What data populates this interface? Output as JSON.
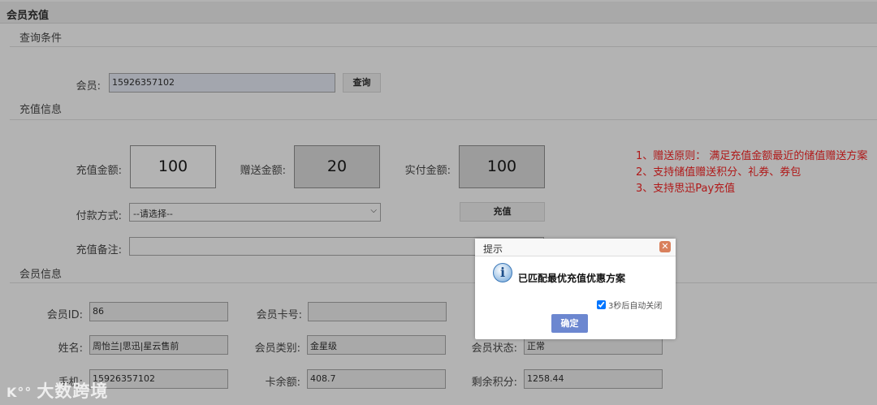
{
  "page": {
    "title": "会员充值"
  },
  "query": {
    "section": "查询条件",
    "member_label": "会员:",
    "member_value": "15926357102",
    "query_button": "查询"
  },
  "recharge": {
    "section": "充值信息",
    "amount_label": "充值金额:",
    "amount": "100",
    "bonus_label": "赠送金额:",
    "bonus": "20",
    "paid_label": "实付金额:",
    "paid": "100",
    "payment_label": "付款方式:",
    "payment_selected": "--请选择--",
    "recharge_button": "充值",
    "remark_label": "充值备注:",
    "remark_value": "",
    "notes": [
      "1、赠送原则： 满足充值金额最近的储值赠送方案",
      "2、支持储值赠送积分、礼券、券包",
      "3、支持思迅Pay充值"
    ]
  },
  "member": {
    "section": "会员信息",
    "fields": [
      {
        "label": "会员ID:",
        "value": "86"
      },
      {
        "label": "会员卡号:",
        "value": ""
      },
      {
        "label": "姓名:",
        "value": "周怡兰|思迅|星云售前"
      },
      {
        "label": "会员类别:",
        "value": "金星级"
      },
      {
        "label": "会员状态:",
        "value": "正常"
      },
      {
        "label": "手机:",
        "value": "15926357102"
      },
      {
        "label": "卡余额:",
        "value": "408.7"
      },
      {
        "label": "剩余积分:",
        "value": "1258.44"
      }
    ]
  },
  "dialog": {
    "title": "提示",
    "message": "已匹配最优充值优惠方案",
    "auto_close_label": "3秒后自动关闭",
    "auto_close_checked": true,
    "ok_button": "确定",
    "close_glyph": "✕",
    "info_glyph": "i"
  },
  "watermark": "大数跨境",
  "colors": {
    "note": "#b01818",
    "ok": "#6c87d0"
  }
}
